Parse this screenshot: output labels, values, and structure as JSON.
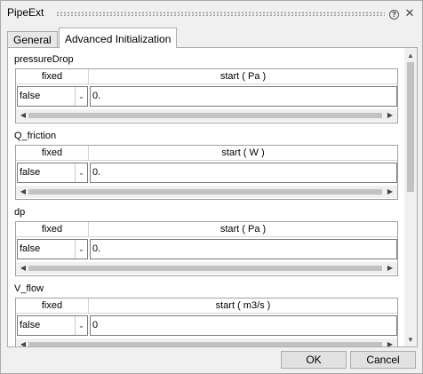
{
  "window": {
    "title": "PipeExt",
    "help_icon": "question-circle-icon",
    "close_icon": "close-icon"
  },
  "tabs": [
    {
      "label": "General",
      "active": false
    },
    {
      "label": "Advanced Initialization",
      "active": true
    }
  ],
  "sections": [
    {
      "label": "pressureDrop",
      "fixed_header": "fixed",
      "start_header": "start ( Pa )",
      "fixed_value": "false",
      "start_value": "0."
    },
    {
      "label": "Q_friction",
      "fixed_header": "fixed",
      "start_header": "start ( W )",
      "fixed_value": "false",
      "start_value": "0."
    },
    {
      "label": "dp",
      "fixed_header": "fixed",
      "start_header": "start ( Pa )",
      "fixed_value": "false",
      "start_value": "0."
    },
    {
      "label": "V_flow",
      "fixed_header": "fixed",
      "start_header": "start ( m3/s )",
      "fixed_value": "false",
      "start_value": "0"
    }
  ],
  "buttons": {
    "ok": "OK",
    "cancel": "Cancel"
  }
}
